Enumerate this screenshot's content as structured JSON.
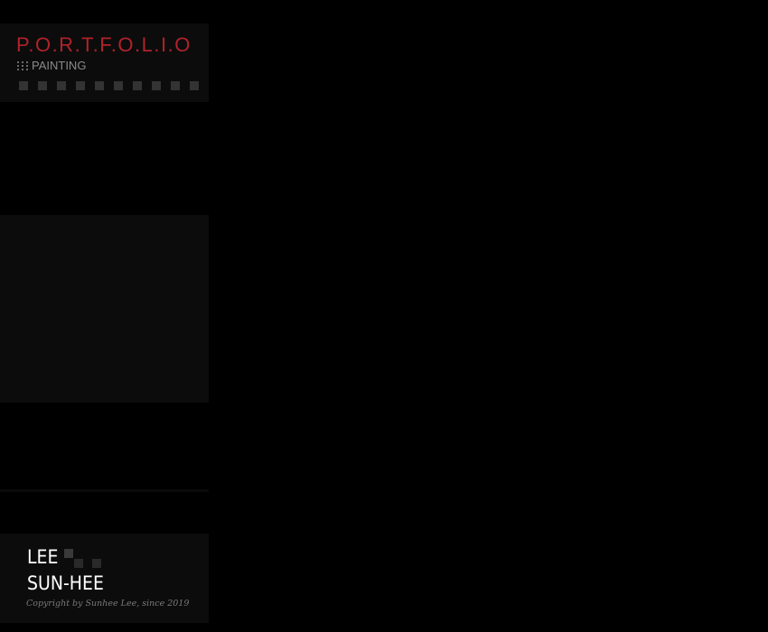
{
  "header": {
    "title": "P.O.R.T.F.O.L.I.O",
    "title_color": "#b0222a",
    "subtitle_icon": "dots-icon",
    "subtitle": "PAINTING"
  },
  "navigation": {
    "squares": [
      {
        "name": "nav-square-1",
        "color": "#333333"
      },
      {
        "name": "nav-square-2",
        "color": "#333333"
      },
      {
        "name": "nav-square-3",
        "color": "#333333"
      },
      {
        "name": "nav-square-4",
        "color": "#333333"
      },
      {
        "name": "nav-square-5",
        "color": "#333333"
      },
      {
        "name": "nav-square-6",
        "color": "#333333"
      },
      {
        "name": "nav-square-7",
        "color": "#333333"
      },
      {
        "name": "nav-square-8",
        "color": "#333333"
      },
      {
        "name": "nav-square-9",
        "color": "#333333"
      },
      {
        "name": "nav-square-10",
        "color": "#333333"
      }
    ]
  },
  "footer": {
    "name_line1": "LEE",
    "name_line2": "SUN-HEE",
    "logo": "squares-logo-icon",
    "copyright": "Copyright by Sunhee Lee, since 2019"
  },
  "colors": {
    "background": "#000000",
    "panel": "#0c0c0c",
    "accent": "#b0222a"
  }
}
